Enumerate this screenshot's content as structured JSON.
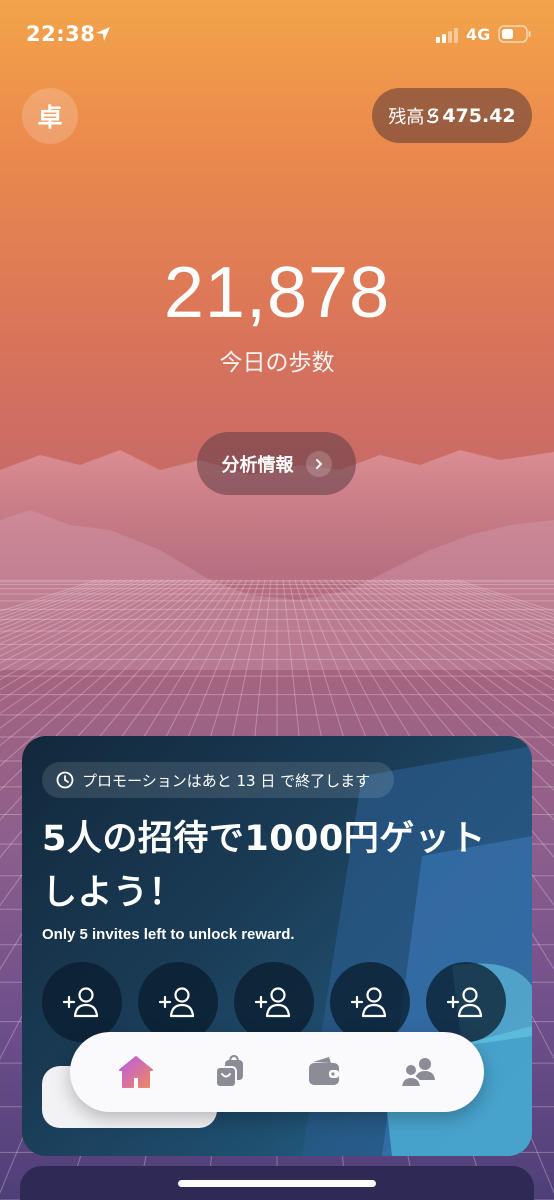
{
  "status_bar": {
    "time": "22:38",
    "network": "4G"
  },
  "header": {
    "avatar_initial": "卓",
    "balance_label": "残高",
    "balance_value": "475.42"
  },
  "main": {
    "steps": "21,878",
    "steps_label": "今日の歩数",
    "analysis_button": "分析情報"
  },
  "promo": {
    "badge": "プロモーションはあと 13 日 で終了します",
    "title": "5人の招待で1000円ゲットしよう！",
    "subtitle": "Only 5 invites left to unlock reward.",
    "invite_slots": 5
  },
  "bottom_nav": {
    "items": [
      {
        "name": "home",
        "icon": "home-icon",
        "active": true
      },
      {
        "name": "shop",
        "icon": "shopping-bags-icon",
        "active": false
      },
      {
        "name": "wallet",
        "icon": "wallet-icon",
        "active": false
      },
      {
        "name": "friends",
        "icon": "people-icon",
        "active": false
      }
    ]
  },
  "colors": {
    "active_gradient_start": "#c456e0",
    "active_gradient_end": "#f08a5d",
    "nav_inactive": "#8c8c96"
  }
}
